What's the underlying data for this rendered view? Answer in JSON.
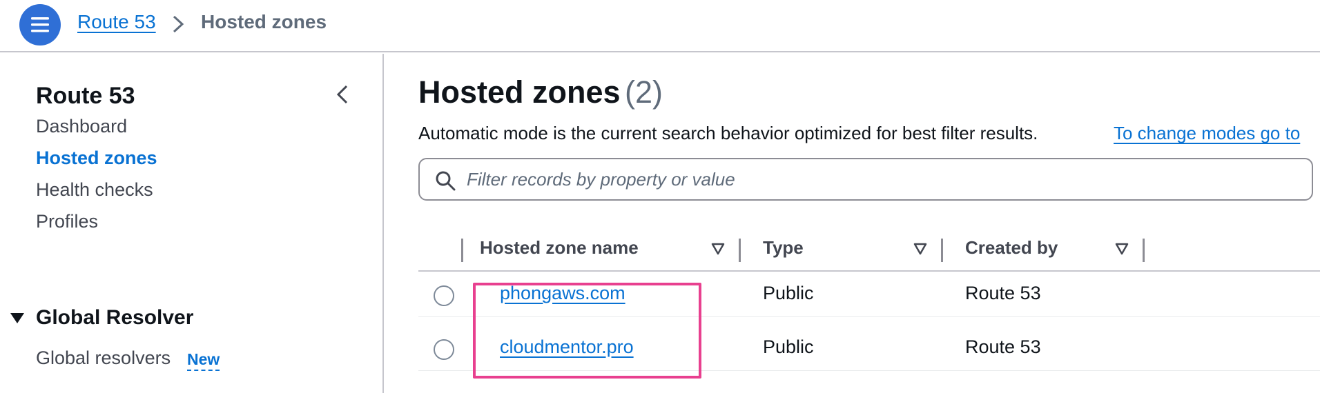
{
  "breadcrumb": {
    "service": "Route 53",
    "current": "Hosted zones"
  },
  "sidebar": {
    "title": "Route 53",
    "items": [
      {
        "label": "Dashboard",
        "active": false
      },
      {
        "label": "Hosted zones",
        "active": true
      },
      {
        "label": "Health checks",
        "active": false
      },
      {
        "label": "Profiles",
        "active": false
      }
    ],
    "section": {
      "label": "Global Resolver",
      "expanded": true,
      "items": [
        {
          "label": "Global resolvers",
          "badge": "New"
        }
      ]
    }
  },
  "main": {
    "title": "Hosted zones",
    "count": "(2)",
    "description": "Automatic mode is the current search behavior optimized for best filter results.",
    "description_link": "To change modes go to",
    "search": {
      "placeholder": "Filter records by property or value",
      "value": ""
    },
    "table": {
      "columns": [
        "Hosted zone name",
        "Type",
        "Created by"
      ],
      "rows": [
        {
          "name": "phongaws.com",
          "type": "Public",
          "created_by": "Route 53",
          "selected": false
        },
        {
          "name": "cloudmentor.pro",
          "type": "Public",
          "created_by": "Route 53",
          "selected": false
        }
      ]
    }
  },
  "colors": {
    "accent": "#0972d3",
    "menu_button": "#2f6fd6",
    "highlight": "#e8408f",
    "text": "#0f141a",
    "muted": "#5f6b7a"
  },
  "icons": {
    "menu": "hamburger-icon",
    "breadcrumb_separator": "chevron-right-icon",
    "collapse": "chevron-left-icon",
    "section_toggle": "caret-down-icon",
    "search": "search-icon",
    "sort": "sort-down-icon"
  }
}
